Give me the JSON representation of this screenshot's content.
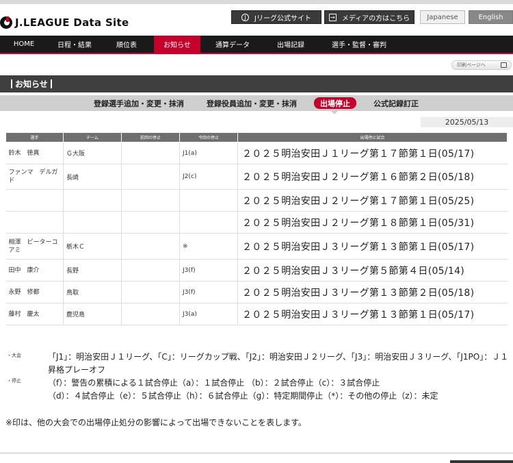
{
  "header": {
    "logo_text": "J.LEAGUE Data Site",
    "official_site_label": "Jリーグ公式サイト",
    "media_label": "メディアの方はこちら",
    "lang_ja": "Japanese",
    "lang_en": "English"
  },
  "nav": {
    "items": [
      {
        "label": "HOME"
      },
      {
        "label": "日程・結果"
      },
      {
        "label": "順位表"
      },
      {
        "label": "お知らせ"
      },
      {
        "label": "通算データ"
      },
      {
        "label": "出場記録"
      },
      {
        "label": "選手・監督・審判"
      }
    ],
    "active_index": 3
  },
  "print_label": "印刷ページへ",
  "section_title": "お知らせ",
  "subtabs": [
    {
      "label": "登録選手追加・変更・抹消"
    },
    {
      "label": "登録役員追加・変更・抹消"
    },
    {
      "label": "出場停止"
    },
    {
      "label": "公式記録訂正"
    }
  ],
  "date": "2025/05/13",
  "table": {
    "headers": [
      "選手",
      "チーム",
      "前回の停止",
      "今回の停止",
      "出場停止試合"
    ],
    "rows": [
      {
        "player": "鈴木　徳真",
        "team": "Ｇ大阪",
        "prev": "",
        "curr": "J1(a)",
        "match": "２０２５明治安田Ｊ１リーグ第１７節第１日(05/17)"
      },
      {
        "player": "ファンマ　デルガド",
        "team": "長崎",
        "prev": "",
        "curr": "J2(c)",
        "match": "２０２５明治安田Ｊ２リーグ第１６節第２日(05/18)"
      },
      {
        "player": "",
        "team": "",
        "prev": "",
        "curr": "",
        "match": "２０２５明治安田Ｊ２リーグ第１７節第１日(05/25)"
      },
      {
        "player": "",
        "team": "",
        "prev": "",
        "curr": "",
        "match": "２０２５明治安田Ｊ２リーグ第１８節第１日(05/31)"
      },
      {
        "player": "相澤　ピーターコアミ",
        "team": "栃木Ｃ",
        "prev": "",
        "curr": "※",
        "match": "２０２５明治安田Ｊ３リーグ第１３節第１日(05/17)"
      },
      {
        "player": "田中　康介",
        "team": "長野",
        "prev": "",
        "curr": "J3(f)",
        "match": "２０２５明治安田Ｊ３リーグ第５節第４日(05/14)"
      },
      {
        "player": "永野　修都",
        "team": "鳥取",
        "prev": "",
        "curr": "J3(f)",
        "match": "２０２５明治安田Ｊ３リーグ第１３節第２日(05/18)"
      },
      {
        "player": "藤村　慶太",
        "team": "鹿児島",
        "prev": "",
        "curr": "J3(a)",
        "match": "２０２５明治安田Ｊ３リーグ第１３節第１日(05/17)"
      }
    ]
  },
  "notes": {
    "tournament_label": "・大会",
    "tournament_text": "「J1」：明治安田Ｊ１リーグ、「C」：リーグカップ戦、「J2」：明治安田Ｊ２リーグ、「J3」：明治安田Ｊ３リーグ、「J1PO」：Ｊ１昇格プレーオフ",
    "suspension_label": "・停止",
    "suspension_text1": "（f）：警告の累積による１試合停止（a）：１試合停止 （b）：２試合停止（c）：３試合停止",
    "suspension_text2": "（d）：４試合停止（e）：５試合停止（h）：６試合停止（g）：特定期間停止（*）：その他の停止（z）：未定",
    "footnote": "※印は、他の大会での出場停止処分の影響によって出場できないことを表します。"
  }
}
